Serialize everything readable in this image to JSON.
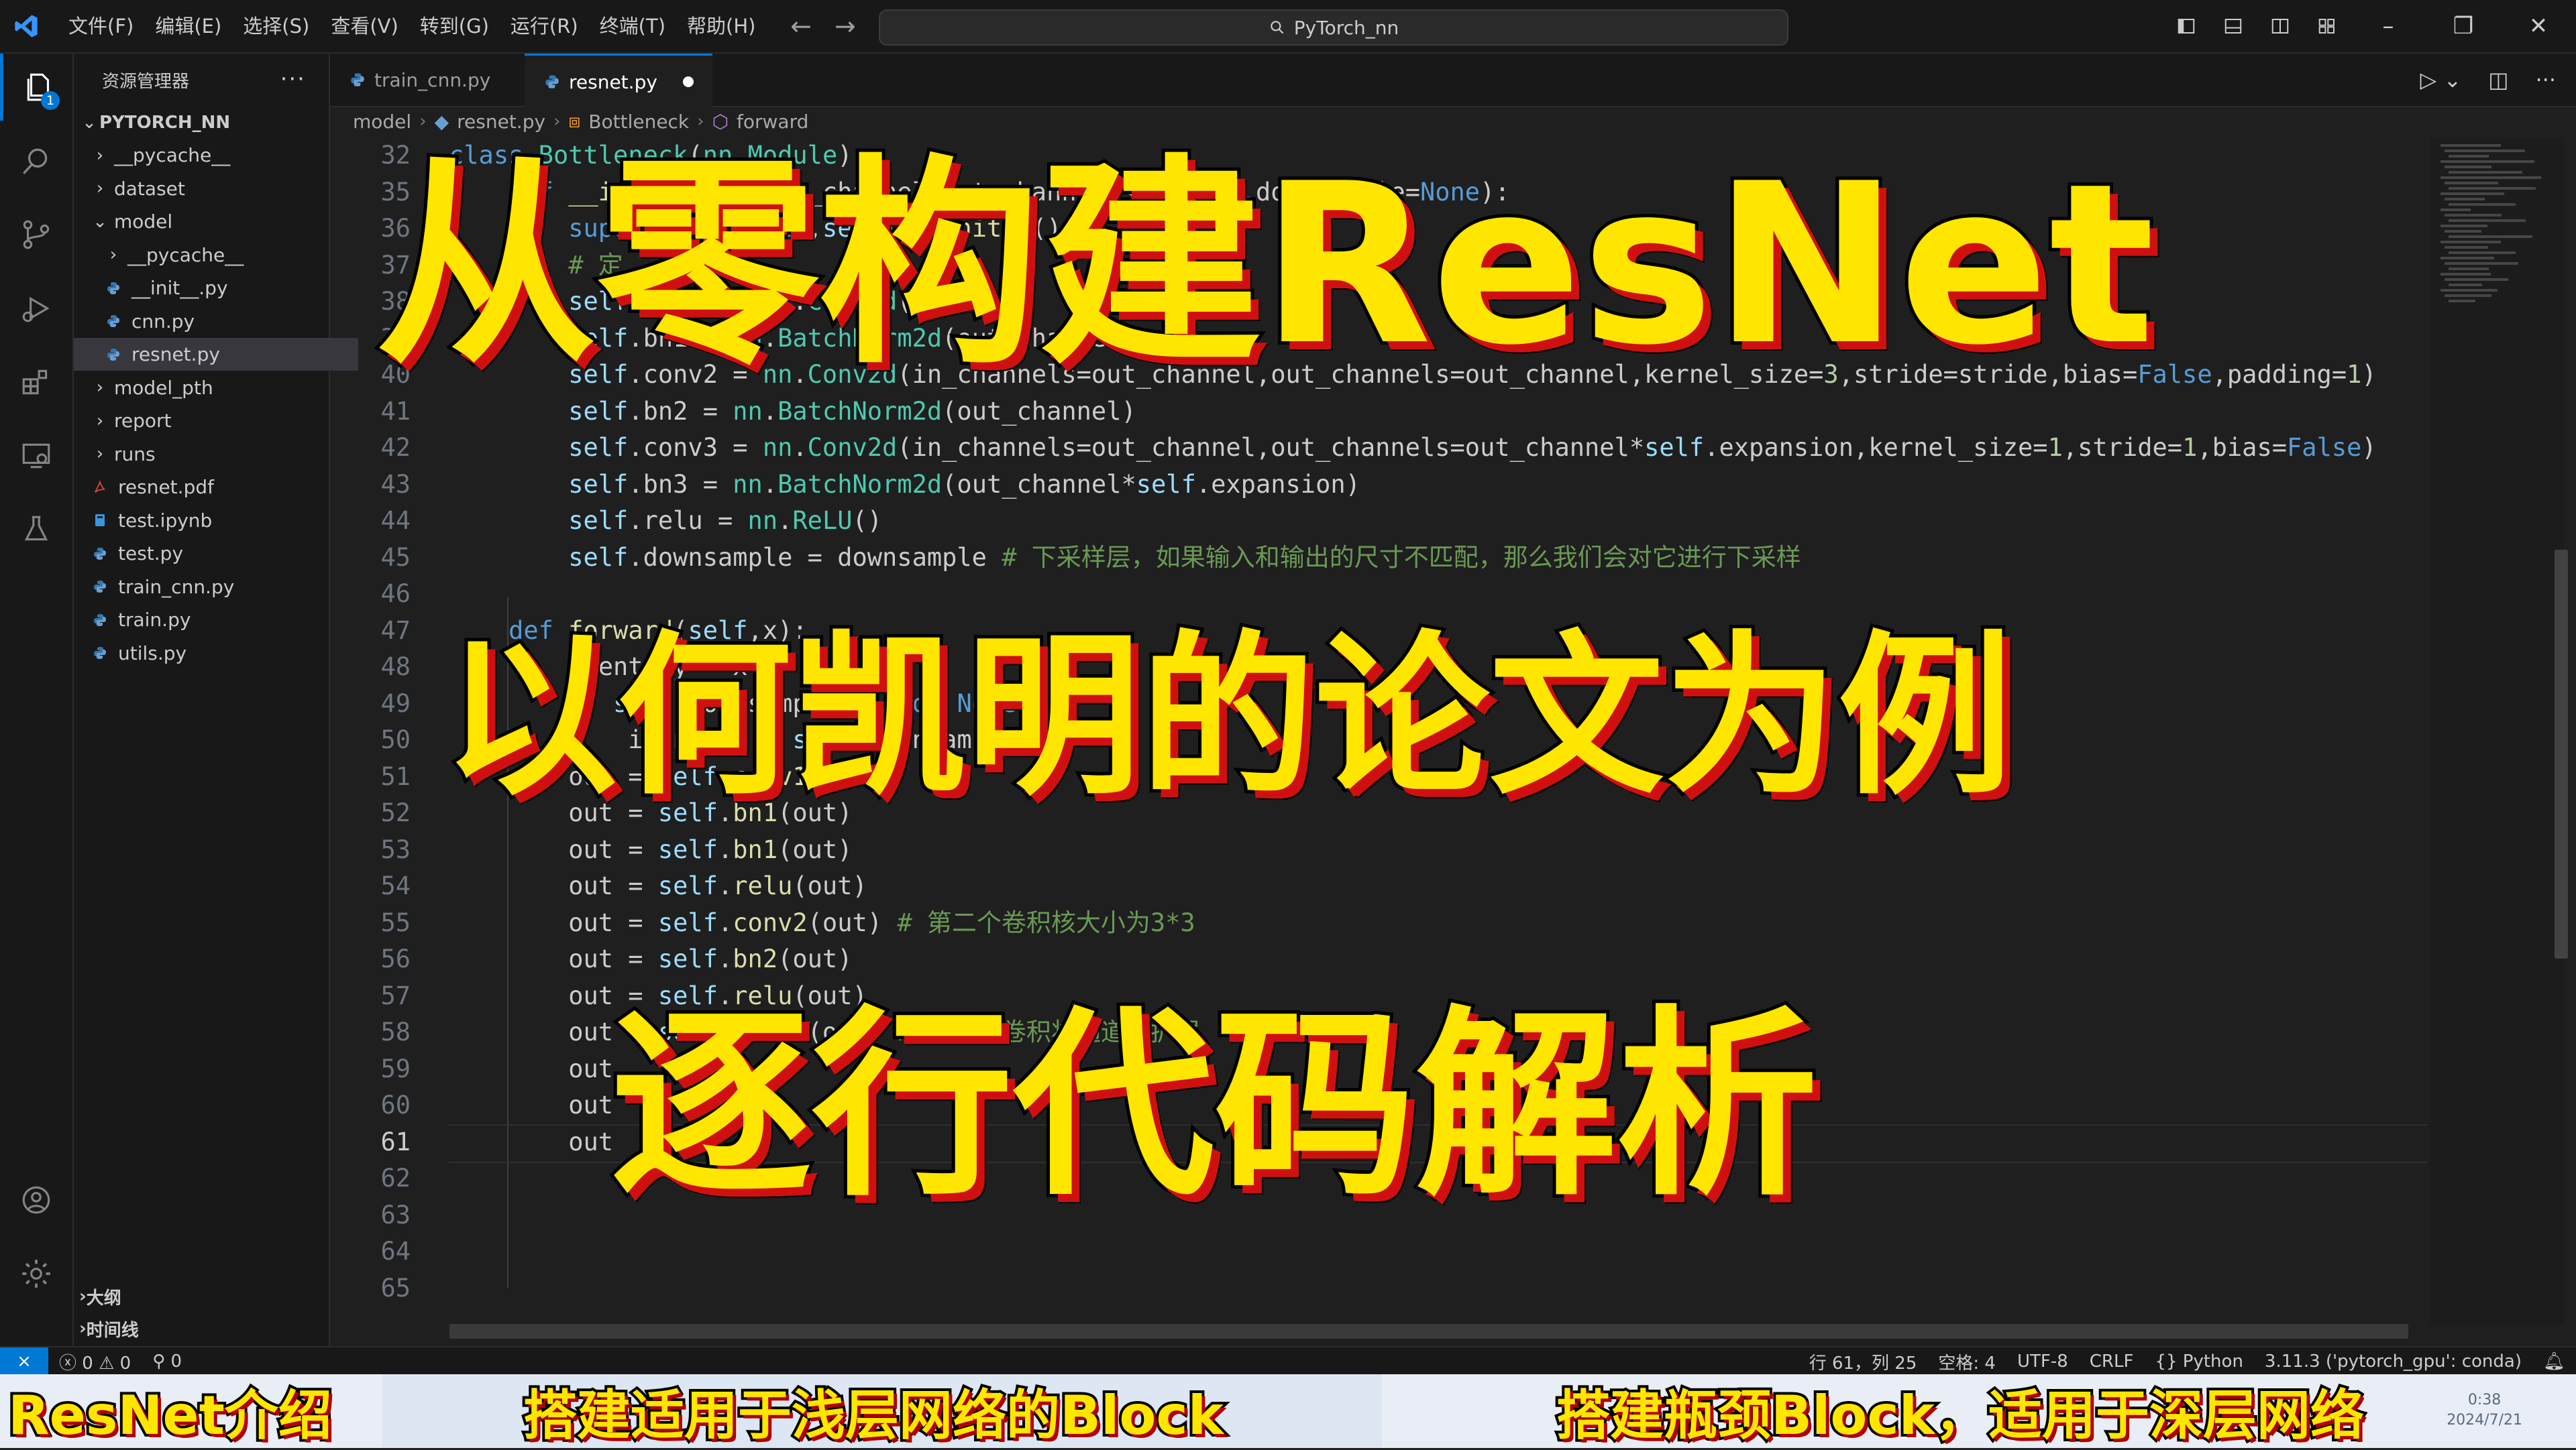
{
  "titlebar": {
    "menu": [
      "文件(F)",
      "编辑(E)",
      "选择(S)",
      "查看(V)",
      "转到(G)",
      "运行(R)",
      "终端(T)",
      "帮助(H)"
    ],
    "search_text": "PyTorch_nn"
  },
  "activity": {
    "explorer_badge": "1"
  },
  "sidebar": {
    "title": "资源管理器",
    "root": "PYTORCH_NN",
    "items": [
      {
        "label": "__pycache__",
        "icon": "chevron-right-icon",
        "indent": 1
      },
      {
        "label": "dataset",
        "icon": "chevron-right-icon",
        "indent": 1
      },
      {
        "label": "model",
        "icon": "chevron-down-icon",
        "indent": 1
      },
      {
        "label": "__pycache__",
        "icon": "chevron-right-icon",
        "indent": 2
      },
      {
        "label": "__init__.py",
        "icon": "python-file-icon",
        "indent": 2
      },
      {
        "label": "cnn.py",
        "icon": "python-file-icon",
        "indent": 2
      },
      {
        "label": "resnet.py",
        "icon": "python-file-icon",
        "indent": 2
      },
      {
        "label": "model_pth",
        "icon": "chevron-right-icon",
        "indent": 1
      },
      {
        "label": "report",
        "icon": "chevron-right-icon",
        "indent": 1
      },
      {
        "label": "runs",
        "icon": "chevron-right-icon",
        "indent": 1
      },
      {
        "label": "resnet.pdf",
        "icon": "pdf-file-icon",
        "indent": 1
      },
      {
        "label": "test.ipynb",
        "icon": "notebook-file-icon",
        "indent": 1
      },
      {
        "label": "test.py",
        "icon": "python-file-icon",
        "indent": 1
      },
      {
        "label": "train_cnn.py",
        "icon": "python-file-icon",
        "indent": 1
      },
      {
        "label": "train.py",
        "icon": "python-file-icon",
        "indent": 1
      },
      {
        "label": "utils.py",
        "icon": "python-file-icon",
        "indent": 1
      }
    ],
    "outline": "大纲",
    "timeline": "时间线"
  },
  "tabs": [
    {
      "label": "train_cnn.py",
      "active": false
    },
    {
      "label": "resnet.py",
      "active": true
    }
  ],
  "breadcrumb": [
    "model",
    "resnet.py",
    "Bottleneck",
    "forward"
  ],
  "code": {
    "lines": [
      {
        "n": "32",
        "text": "class Bottleneck(nn.Module):"
      },
      {
        "n": "35",
        "text": "    def __init__(self,in_channel,out_channel,stride=1,downsample=None):"
      },
      {
        "n": "36",
        "text": "        super(Bottleneck,self).__init__()"
      },
      {
        "n": "37",
        "text": "        # 定"
      },
      {
        "n": "38",
        "text": "        self.conv1 = nn.Conv2d("
      },
      {
        "n": "39",
        "text": "        self.bn1 = nn.BatchNorm2d(out_channel)"
      },
      {
        "n": "40",
        "text": "        self.conv2 = nn.Conv2d(in_channels=out_channel,out_channels=out_channel,kernel_size=3,stride=stride,bias=False,padding=1)"
      },
      {
        "n": "41",
        "text": "        self.bn2 = nn.BatchNorm2d(out_channel)"
      },
      {
        "n": "42",
        "text": "        self.conv3 = nn.Conv2d(in_channels=out_channel,out_channels=out_channel*self.expansion,kernel_size=1,stride=1,bias=False)"
      },
      {
        "n": "43",
        "text": "        self.bn3 = nn.BatchNorm2d(out_channel*self.expansion)"
      },
      {
        "n": "44",
        "text": "        self.relu = nn.ReLU()"
      },
      {
        "n": "45",
        "text": "        self.downsample = downsample # 下采样层，如果输入和输出的尺寸不匹配，那么我们会对它进行下采样"
      },
      {
        "n": "46",
        "text": ""
      },
      {
        "n": "47",
        "text": "    def forward(self,x):"
      },
      {
        "n": "48",
        "text": "        identity = x"
      },
      {
        "n": "49",
        "text": "        if self.downsample is not None:"
      },
      {
        "n": "50",
        "text": "            identity = self.downsample(x)"
      },
      {
        "n": "51",
        "text": "        out = self.conv1(x)"
      },
      {
        "n": "52",
        "text": "        out = self.bn1(out)"
      },
      {
        "n": "53",
        "text": "        out = self.bn1(out)"
      },
      {
        "n": "54",
        "text": "        out = self.relu(out)"
      },
      {
        "n": "55",
        "text": "        out = self.conv2(out) # 第二个卷积核大小为3*3"
      },
      {
        "n": "56",
        "text": "        out = self.bn2(out)"
      },
      {
        "n": "57",
        "text": "        out = self.relu(out)"
      },
      {
        "n": "58",
        "text": "        out = self.conv3(out) # 第三个卷积将通道数扩展"
      },
      {
        "n": "59",
        "text": "        out"
      },
      {
        "n": "60",
        "text": "        out"
      },
      {
        "n": "61",
        "text": "        out"
      },
      {
        "n": "62",
        "text": ""
      },
      {
        "n": "63",
        "text": ""
      },
      {
        "n": "64",
        "text": ""
      },
      {
        "n": "65",
        "text": ""
      }
    ],
    "current_line": "61"
  },
  "overlay": {
    "title1": "从零构建ResNet",
    "title2": "以何凯明的论文为例",
    "title3": "逐行代码解析"
  },
  "status": {
    "errors": "0",
    "warnings": "0",
    "ports": "0",
    "position": "行 61，列 25",
    "spaces": "空格: 4",
    "encoding": "UTF-8",
    "eol": "CRLF",
    "language": "Python",
    "interpreter": "3.11.3 ('pytorch_gpu': conda)"
  },
  "chapters": [
    "ResNet介绍",
    "搭建适用于浅层网络的Block",
    "搭建瓶颈Block，适用于深层网络"
  ],
  "clock": {
    "time": "0:38",
    "date": "2024/7/21"
  },
  "colors": {
    "accent": "#0078d4",
    "title_yellow": "#ffe600",
    "title_shadow": "#d01010"
  }
}
